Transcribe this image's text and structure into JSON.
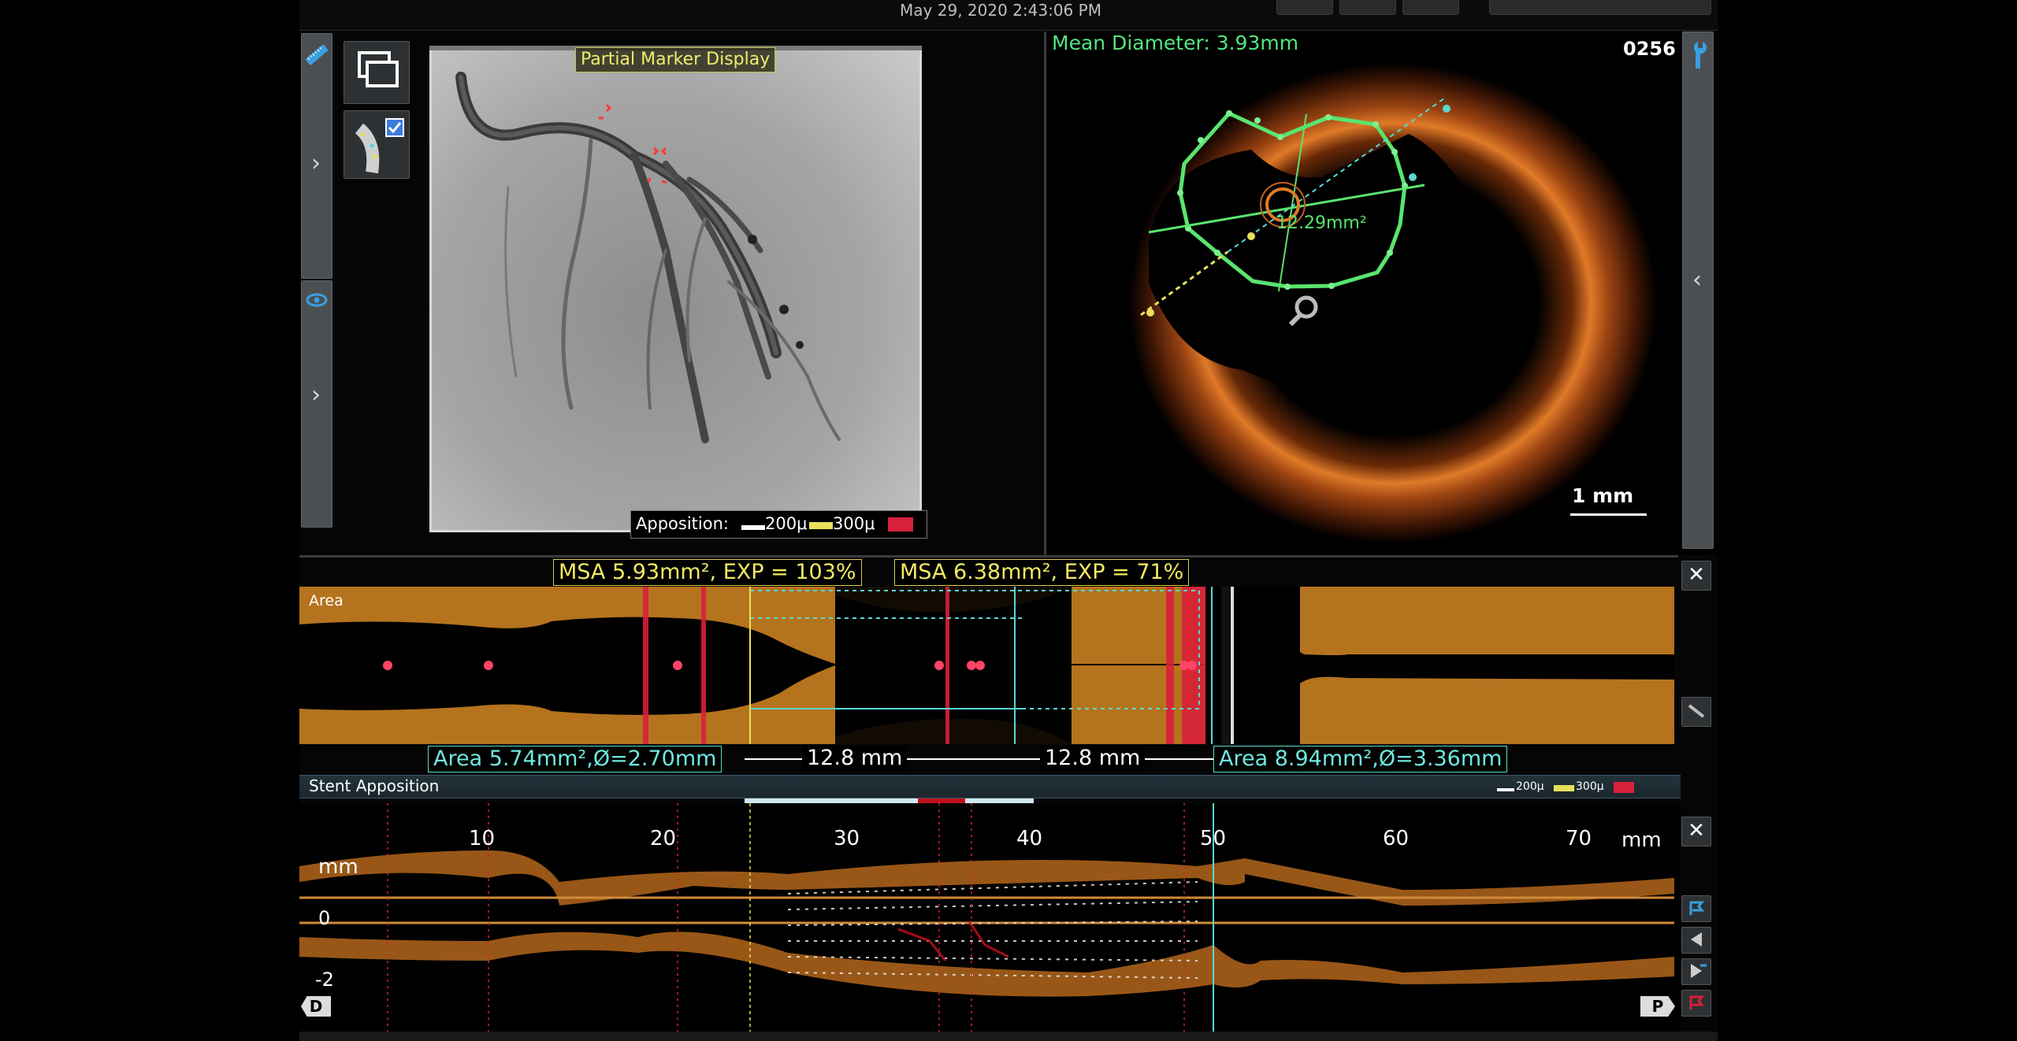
{
  "header": {
    "datetime": "May 29, 2020 2:43:06 PM"
  },
  "angio": {
    "marker_label": "Partial Marker Display",
    "apposition_label": "Apposition:",
    "legend_200": "200μ",
    "legend_300": "300μ"
  },
  "oct": {
    "mean_diameter": "Mean Diameter:  3.93mm",
    "frame_number": "0256",
    "lumen_area": "12.29mm²",
    "scale_label": "1 mm"
  },
  "area_chart": {
    "label": "Area",
    "msa_left": "MSA 5.93mm², EXP = 103%",
    "msa_right": "MSA 6.38mm², EXP = 71%",
    "area_left": "Area 5.74mm²,Ø=2.70mm",
    "length_left": "12.8 mm",
    "length_right": "12.8 mm",
    "area_right": "Area 8.94mm²,Ø=3.36mm"
  },
  "stent_apposition": {
    "title": "Stent Apposition",
    "legend_200": "200μ",
    "legend_300": "300μ"
  },
  "long_view": {
    "ticks": [
      "10",
      "20",
      "30",
      "40",
      "50",
      "60",
      "70"
    ],
    "unit": "mm",
    "y_unit": "mm",
    "y_zero": "0",
    "y_neg": "-2",
    "distal": "D",
    "proximal": "P"
  },
  "colors": {
    "lumen": "#59e46e",
    "accent_cyan": "#5ad8d2",
    "accent_yellow": "#e8e05a",
    "malapposition_red": "#d8203a",
    "tissue_orange": "#b5731e"
  }
}
